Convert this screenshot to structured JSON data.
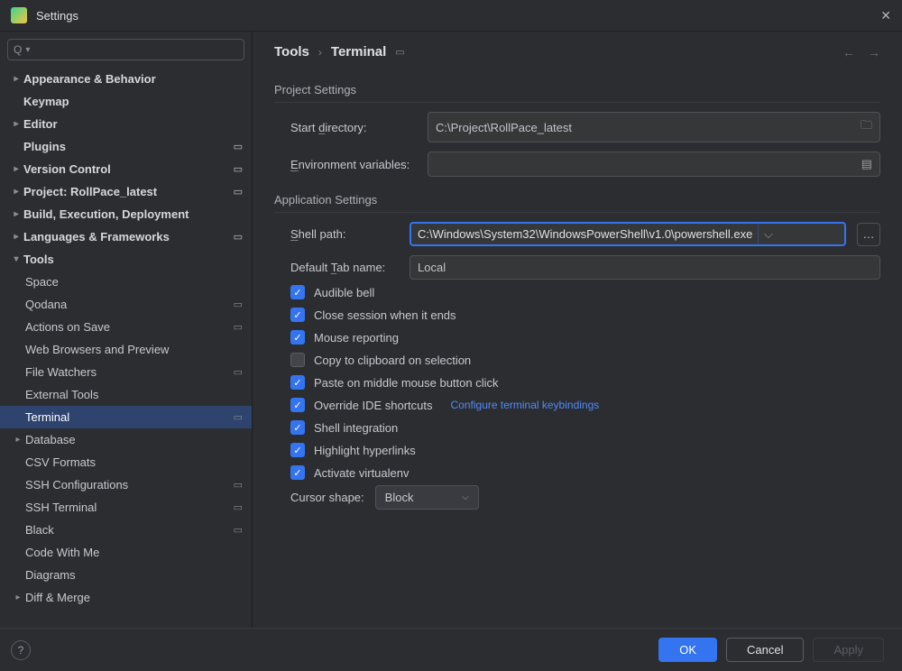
{
  "window": {
    "title": "Settings"
  },
  "search": {
    "placeholder": ""
  },
  "sidebar": {
    "items": [
      {
        "label": "Appearance & Behavior",
        "bold": true,
        "arrow": "closed",
        "depth": 0
      },
      {
        "label": "Keymap",
        "bold": true,
        "depth": 0,
        "pad": true
      },
      {
        "label": "Editor",
        "bold": true,
        "arrow": "closed",
        "depth": 0
      },
      {
        "label": "Plugins",
        "bold": true,
        "depth": 0,
        "pad": true,
        "mod": true
      },
      {
        "label": "Version Control",
        "bold": true,
        "arrow": "closed",
        "depth": 0,
        "mod": true
      },
      {
        "label": "Project: RollPace_latest",
        "bold": true,
        "arrow": "closed",
        "depth": 0,
        "mod": true
      },
      {
        "label": "Build, Execution, Deployment",
        "bold": true,
        "arrow": "closed",
        "depth": 0
      },
      {
        "label": "Languages & Frameworks",
        "bold": true,
        "arrow": "closed",
        "depth": 0,
        "mod": true
      },
      {
        "label": "Tools",
        "bold": true,
        "arrow": "open",
        "depth": 0
      },
      {
        "label": "Space",
        "depth": 1
      },
      {
        "label": "Qodana",
        "depth": 1,
        "mod": true
      },
      {
        "label": "Actions on Save",
        "depth": 1,
        "mod": true
      },
      {
        "label": "Web Browsers and Preview",
        "depth": 1
      },
      {
        "label": "File Watchers",
        "depth": 1,
        "mod": true
      },
      {
        "label": "External Tools",
        "depth": 1
      },
      {
        "label": "Terminal",
        "depth": 1,
        "mod": true,
        "selected": true
      },
      {
        "label": "Database",
        "depth": 1,
        "arrow": "closed"
      },
      {
        "label": "CSV Formats",
        "depth": 1
      },
      {
        "label": "SSH Configurations",
        "depth": 1,
        "mod": true
      },
      {
        "label": "SSH Terminal",
        "depth": 1,
        "mod": true
      },
      {
        "label": "Black",
        "depth": 1,
        "mod": true
      },
      {
        "label": "Code With Me",
        "depth": 1
      },
      {
        "label": "Diagrams",
        "depth": 1
      },
      {
        "label": "Diff & Merge",
        "depth": 1,
        "arrow": "closed"
      }
    ]
  },
  "breadcrumb": {
    "root": "Tools",
    "leaf": "Terminal"
  },
  "section1": "Project Settings",
  "start_dir": {
    "label": "Start directory:",
    "value": "C:\\Project\\RollPace_latest"
  },
  "env": {
    "label": "Environment variables:",
    "value": ""
  },
  "section2": "Application Settings",
  "shell": {
    "label": "Shell path:",
    "value": "C:\\Windows\\System32\\WindowsPowerShell\\v1.0\\powershell.exe"
  },
  "tab": {
    "label": "Default Tab name:",
    "value": "Local"
  },
  "checks": [
    {
      "on": true,
      "label": "Audible bell"
    },
    {
      "on": true,
      "label": "Close session when it ends"
    },
    {
      "on": true,
      "label": "Mouse reporting"
    },
    {
      "on": false,
      "label": "Copy to clipboard on selection"
    },
    {
      "on": true,
      "label": "Paste on middle mouse button click"
    },
    {
      "on": true,
      "label": "Override IDE shortcuts",
      "link": "Configure terminal keybindings"
    },
    {
      "on": true,
      "label": "Shell integration"
    },
    {
      "on": true,
      "label": "Highlight hyperlinks"
    },
    {
      "on": true,
      "label": "Activate virtualenv"
    }
  ],
  "cursor": {
    "label": "Cursor shape:",
    "value": "Block"
  },
  "buttons": {
    "ok": "OK",
    "cancel": "Cancel",
    "apply": "Apply"
  }
}
